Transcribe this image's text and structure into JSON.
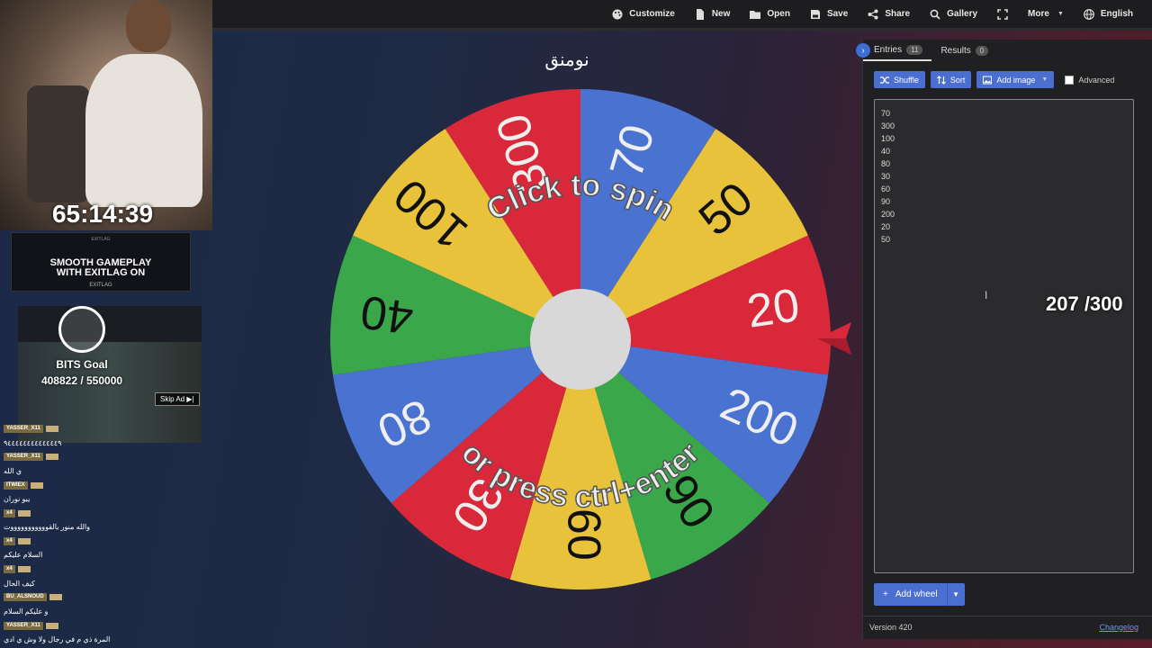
{
  "nav": {
    "items": [
      {
        "label": "Customize",
        "icon": "palette-icon"
      },
      {
        "label": "New",
        "icon": "file-icon"
      },
      {
        "label": "Open",
        "icon": "folder-icon"
      },
      {
        "label": "Save",
        "icon": "save-icon"
      },
      {
        "label": "Share",
        "icon": "share-icon"
      },
      {
        "label": "Gallery",
        "icon": "search-icon"
      },
      {
        "label": "",
        "icon": "fullscreen-icon"
      },
      {
        "label": "More",
        "icon": "chevron-down-icon"
      },
      {
        "label": "English",
        "icon": "globe-icon"
      }
    ]
  },
  "wheel": {
    "title": "نومنق",
    "center_text_top": "Click to spin",
    "center_text_bottom": "or press ctrl+enter",
    "segments": [
      {
        "label": "70",
        "color": "#4a72d0"
      },
      {
        "label": "50",
        "color": "#e8c23a"
      },
      {
        "label": "20",
        "color": "#d9283a"
      },
      {
        "label": "200",
        "color": "#4a72d0"
      },
      {
        "label": "90",
        "color": "#3aa84a"
      },
      {
        "label": "60",
        "color": "#e8c23a"
      },
      {
        "label": "30",
        "color": "#d9283a"
      },
      {
        "label": "80",
        "color": "#4a72d0"
      },
      {
        "label": "40",
        "color": "#3aa84a"
      },
      {
        "label": "100",
        "color": "#e8c23a"
      },
      {
        "label": "300",
        "color": "#d9283a"
      }
    ]
  },
  "panel": {
    "tab_entries": "Entries",
    "tab_entries_count": "11",
    "tab_results": "Results",
    "tab_results_count": "0",
    "shuffle_label": "Shuffle",
    "sort_label": "Sort",
    "add_image_label": "Add image",
    "advanced_label": "Advanced",
    "entries": [
      "70",
      "300",
      "100",
      "40",
      "80",
      "30",
      "60",
      "90",
      "200",
      "20",
      "50"
    ],
    "add_wheel_label": "Add wheel",
    "version": "Version 420",
    "changelog": "Changelog"
  },
  "overlay": {
    "count": "207 /300",
    "timer": "65:14:39",
    "ad_small": "EXITLAG",
    "ad_text_line1": "SMOOTH GAMEPLAY",
    "ad_text_line2": "WITH EXITLAG ON",
    "ad_brand": "EXITLAG",
    "bits_label": "BITS Goal",
    "bits_value": "408822 / 550000",
    "skip_ad": "Skip Ad ▶|"
  },
  "chat": [
    {
      "user": "YASSER_X11",
      "text": ""
    },
    {
      "user": "",
      "text": "٩٤٤٤٤٤٤٤٤٤٤٤٤٤٩"
    },
    {
      "user": "YASSER_X11",
      "text": ""
    },
    {
      "user": "",
      "text": "ي الله"
    },
    {
      "user": "ITWIEX",
      "text": ""
    },
    {
      "user": "",
      "text": "يبو نوران"
    },
    {
      "user": "x4",
      "text": ""
    },
    {
      "user": "",
      "text": "والله منور بالقوووووووووووت"
    },
    {
      "user": "x4",
      "text": ""
    },
    {
      "user": "",
      "text": "السلام عليكم"
    },
    {
      "user": "x4",
      "text": ""
    },
    {
      "user": "",
      "text": "كيف الحال"
    },
    {
      "user": "BU_ALSNOUD",
      "text": ""
    },
    {
      "user": "",
      "text": "و عليكم السلام"
    },
    {
      "user": "YASSER_X11",
      "text": ""
    },
    {
      "user": "",
      "text": "المرة ذي م في رجال ولا وش ي ادي"
    }
  ]
}
